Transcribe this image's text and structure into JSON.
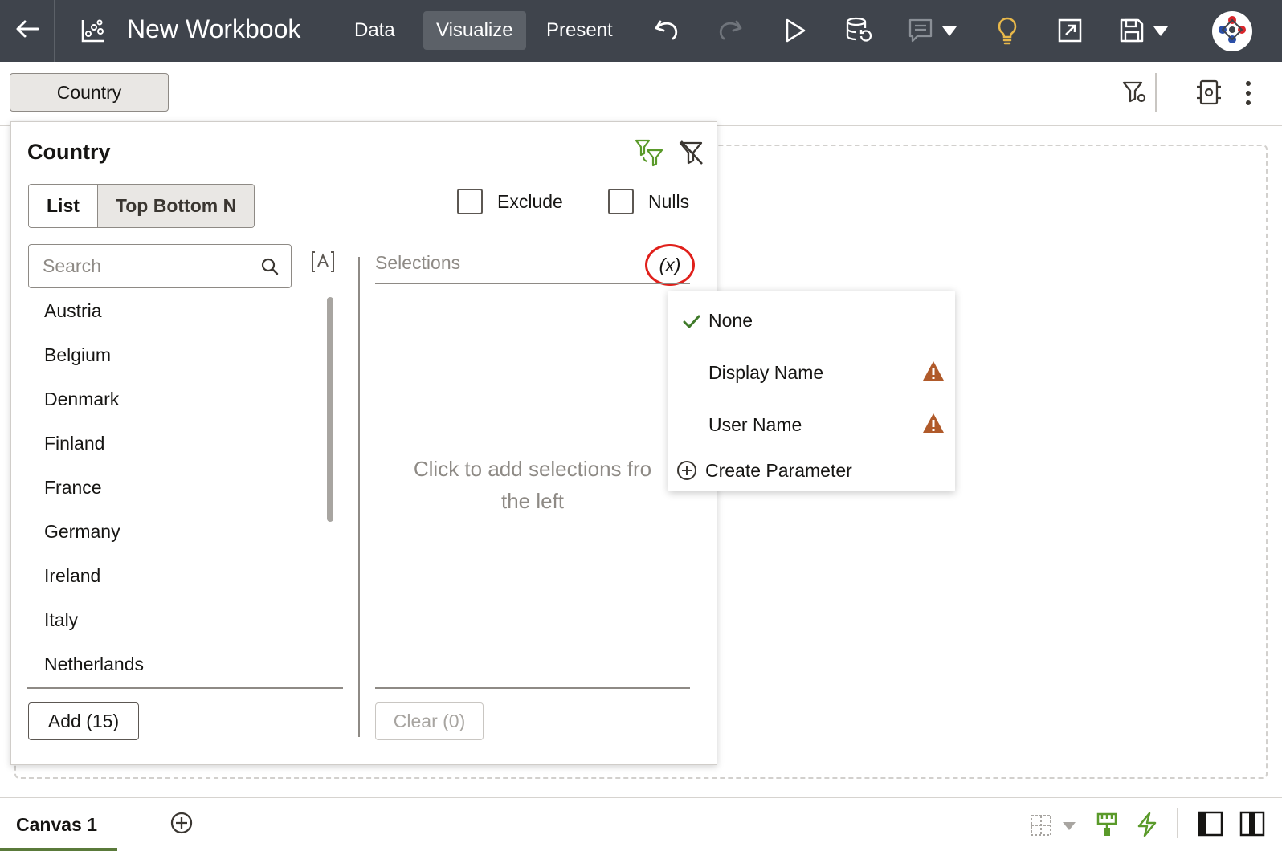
{
  "app": {
    "title": "New Workbook",
    "tabs": [
      {
        "label": "Data",
        "active": false
      },
      {
        "label": "Visualize",
        "active": true
      },
      {
        "label": "Present",
        "active": false
      }
    ],
    "toolbar_icons": [
      "back-arrow-icon",
      "workbook-icon",
      "undo-icon",
      "redo-icon",
      "play-icon",
      "data-refresh-icon",
      "comment-icon",
      "chevron-down-icon",
      "lightbulb-icon",
      "export-icon",
      "save-icon",
      "chevron-down-icon",
      "avatar-logo-icon"
    ]
  },
  "filterbar": {
    "pill_label": "Country",
    "icons": [
      "filter-settings-icon",
      "properties-icon",
      "more-vertical-icon"
    ]
  },
  "filter_panel": {
    "title": "Country",
    "header_icons": [
      "auto-apply-filter-icon",
      "clear-filter-icon"
    ],
    "mode_tabs": [
      {
        "label": "List",
        "active": true
      },
      {
        "label": "Top Bottom N",
        "active": false
      }
    ],
    "exclude_label": "Exclude",
    "nulls_label": "Nulls",
    "search_placeholder": "Search",
    "list_items": [
      "Austria",
      "Belgium",
      "Denmark",
      "Finland",
      "France",
      "Germany",
      "Ireland",
      "Italy",
      "Netherlands"
    ],
    "add_button": "Add (15)",
    "selections_label": "Selections",
    "parameter_button": "(x)",
    "empty_message_line1": "Click to add selections fro",
    "empty_message_line2": "the left",
    "clear_button": "Clear (0)"
  },
  "parameter_menu": {
    "items": [
      {
        "label": "None",
        "checked": true,
        "warning": false
      },
      {
        "label": "Display Name",
        "checked": false,
        "warning": true
      },
      {
        "label": "User Name",
        "checked": false,
        "warning": true
      }
    ],
    "create_label": "Create Parameter"
  },
  "bottombar": {
    "canvas_tab": "Canvas 1",
    "icons": [
      "add-canvas-icon",
      "layout-grid-icon",
      "chevron-down-icon",
      "format-brush-icon",
      "lightning-icon",
      "panel-left-icon",
      "panel-split-icon"
    ]
  },
  "colors": {
    "topbar_bg": "#3f444c",
    "accent_green": "#5a7a3a",
    "highlight_red": "#e0201b",
    "warning_orange": "#b05a2a",
    "lightbulb_yellow": "#e8b84a"
  }
}
